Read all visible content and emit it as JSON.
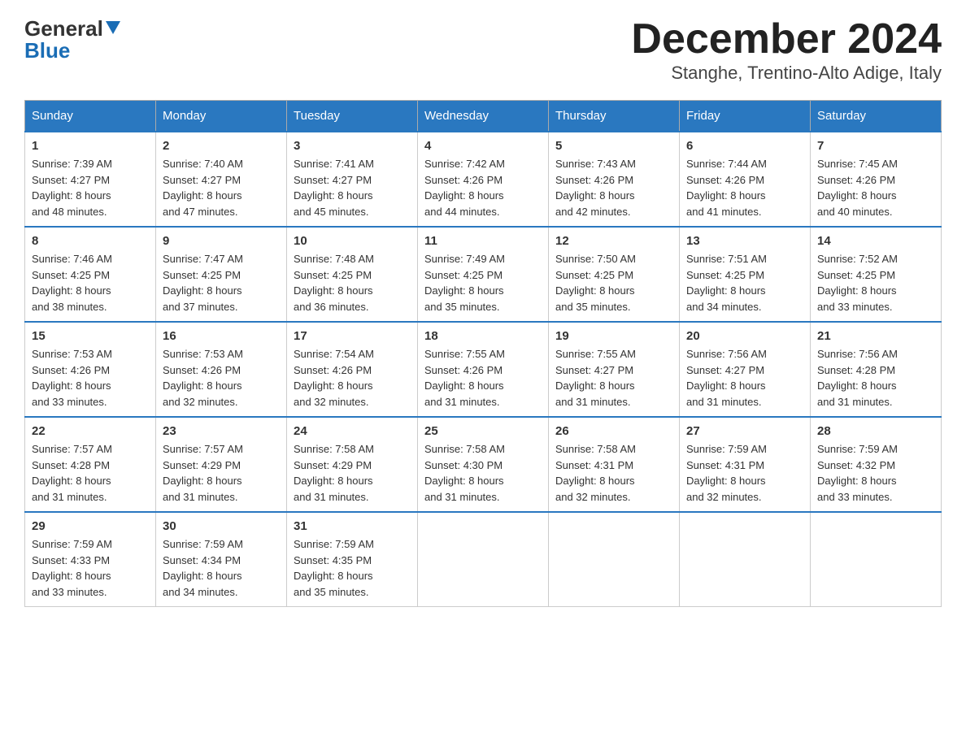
{
  "header": {
    "logo_line1": "General",
    "logo_line2": "Blue",
    "title": "December 2024",
    "subtitle": "Stanghe, Trentino-Alto Adige, Italy"
  },
  "days_of_week": [
    "Sunday",
    "Monday",
    "Tuesday",
    "Wednesday",
    "Thursday",
    "Friday",
    "Saturday"
  ],
  "weeks": [
    [
      {
        "day": "1",
        "sunrise": "7:39 AM",
        "sunset": "4:27 PM",
        "daylight": "8 hours and 48 minutes."
      },
      {
        "day": "2",
        "sunrise": "7:40 AM",
        "sunset": "4:27 PM",
        "daylight": "8 hours and 47 minutes."
      },
      {
        "day": "3",
        "sunrise": "7:41 AM",
        "sunset": "4:27 PM",
        "daylight": "8 hours and 45 minutes."
      },
      {
        "day": "4",
        "sunrise": "7:42 AM",
        "sunset": "4:26 PM",
        "daylight": "8 hours and 44 minutes."
      },
      {
        "day": "5",
        "sunrise": "7:43 AM",
        "sunset": "4:26 PM",
        "daylight": "8 hours and 42 minutes."
      },
      {
        "day": "6",
        "sunrise": "7:44 AM",
        "sunset": "4:26 PM",
        "daylight": "8 hours and 41 minutes."
      },
      {
        "day": "7",
        "sunrise": "7:45 AM",
        "sunset": "4:26 PM",
        "daylight": "8 hours and 40 minutes."
      }
    ],
    [
      {
        "day": "8",
        "sunrise": "7:46 AM",
        "sunset": "4:25 PM",
        "daylight": "8 hours and 38 minutes."
      },
      {
        "day": "9",
        "sunrise": "7:47 AM",
        "sunset": "4:25 PM",
        "daylight": "8 hours and 37 minutes."
      },
      {
        "day": "10",
        "sunrise": "7:48 AM",
        "sunset": "4:25 PM",
        "daylight": "8 hours and 36 minutes."
      },
      {
        "day": "11",
        "sunrise": "7:49 AM",
        "sunset": "4:25 PM",
        "daylight": "8 hours and 35 minutes."
      },
      {
        "day": "12",
        "sunrise": "7:50 AM",
        "sunset": "4:25 PM",
        "daylight": "8 hours and 35 minutes."
      },
      {
        "day": "13",
        "sunrise": "7:51 AM",
        "sunset": "4:25 PM",
        "daylight": "8 hours and 34 minutes."
      },
      {
        "day": "14",
        "sunrise": "7:52 AM",
        "sunset": "4:25 PM",
        "daylight": "8 hours and 33 minutes."
      }
    ],
    [
      {
        "day": "15",
        "sunrise": "7:53 AM",
        "sunset": "4:26 PM",
        "daylight": "8 hours and 33 minutes."
      },
      {
        "day": "16",
        "sunrise": "7:53 AM",
        "sunset": "4:26 PM",
        "daylight": "8 hours and 32 minutes."
      },
      {
        "day": "17",
        "sunrise": "7:54 AM",
        "sunset": "4:26 PM",
        "daylight": "8 hours and 32 minutes."
      },
      {
        "day": "18",
        "sunrise": "7:55 AM",
        "sunset": "4:26 PM",
        "daylight": "8 hours and 31 minutes."
      },
      {
        "day": "19",
        "sunrise": "7:55 AM",
        "sunset": "4:27 PM",
        "daylight": "8 hours and 31 minutes."
      },
      {
        "day": "20",
        "sunrise": "7:56 AM",
        "sunset": "4:27 PM",
        "daylight": "8 hours and 31 minutes."
      },
      {
        "day": "21",
        "sunrise": "7:56 AM",
        "sunset": "4:28 PM",
        "daylight": "8 hours and 31 minutes."
      }
    ],
    [
      {
        "day": "22",
        "sunrise": "7:57 AM",
        "sunset": "4:28 PM",
        "daylight": "8 hours and 31 minutes."
      },
      {
        "day": "23",
        "sunrise": "7:57 AM",
        "sunset": "4:29 PM",
        "daylight": "8 hours and 31 minutes."
      },
      {
        "day": "24",
        "sunrise": "7:58 AM",
        "sunset": "4:29 PM",
        "daylight": "8 hours and 31 minutes."
      },
      {
        "day": "25",
        "sunrise": "7:58 AM",
        "sunset": "4:30 PM",
        "daylight": "8 hours and 31 minutes."
      },
      {
        "day": "26",
        "sunrise": "7:58 AM",
        "sunset": "4:31 PM",
        "daylight": "8 hours and 32 minutes."
      },
      {
        "day": "27",
        "sunrise": "7:59 AM",
        "sunset": "4:31 PM",
        "daylight": "8 hours and 32 minutes."
      },
      {
        "day": "28",
        "sunrise": "7:59 AM",
        "sunset": "4:32 PM",
        "daylight": "8 hours and 33 minutes."
      }
    ],
    [
      {
        "day": "29",
        "sunrise": "7:59 AM",
        "sunset": "4:33 PM",
        "daylight": "8 hours and 33 minutes."
      },
      {
        "day": "30",
        "sunrise": "7:59 AM",
        "sunset": "4:34 PM",
        "daylight": "8 hours and 34 minutes."
      },
      {
        "day": "31",
        "sunrise": "7:59 AM",
        "sunset": "4:35 PM",
        "daylight": "8 hours and 35 minutes."
      },
      null,
      null,
      null,
      null
    ]
  ],
  "labels": {
    "sunrise": "Sunrise:",
    "sunset": "Sunset:",
    "daylight": "Daylight:"
  }
}
